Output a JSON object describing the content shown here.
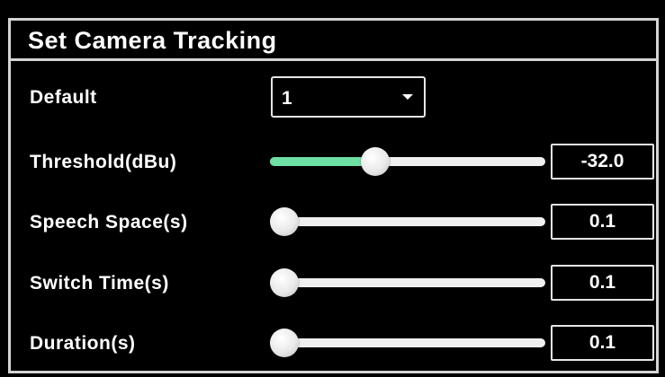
{
  "dialog": {
    "title": "Set Camera Tracking"
  },
  "default": {
    "label": "Default",
    "value": "1",
    "icon": "caret-down-icon"
  },
  "sliders": [
    {
      "label": "Threshold(dBu)",
      "value": "-32.0",
      "level": 0.37,
      "fill_color": "#6ee0a4"
    },
    {
      "label": "Speech Space(s)",
      "value": "0.1",
      "level": 0.0
    },
    {
      "label": "Switch Time(s)",
      "value": "0.1",
      "level": 0.0
    },
    {
      "label": "Duration(s)",
      "value": "0.1",
      "level": 0.0
    }
  ]
}
